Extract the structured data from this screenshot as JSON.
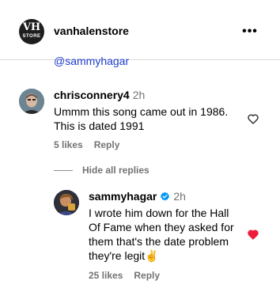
{
  "post": {
    "username": "vanhalenstore",
    "logo_text": "VH",
    "logo_subtext": "STORE",
    "more_icon": "more-horizontal-icon",
    "caption_mention": "@sammyhagar"
  },
  "comment": {
    "username": "chrisconnery4",
    "time": "2h",
    "text_line1": "Ummm this song came out in 1986.",
    "text_line2": "This is dated 1991",
    "likes": "5 likes",
    "reply": "Reply",
    "liked": false
  },
  "hide_replies": "Hide all replies",
  "reply": {
    "username": "sammyhagar",
    "time": "2h",
    "verified": true,
    "lines": [
      "I wrote him down for the Hall",
      "Of Fame when they asked for",
      "them that's the date problem",
      "they're legit✌️"
    ],
    "likes": "25 likes",
    "reply": "Reply",
    "liked": true
  },
  "colors": {
    "link": "#1e3dcc",
    "muted": "#737373",
    "heart_liked": "#ed1c3a",
    "verified": "#0095f6"
  }
}
